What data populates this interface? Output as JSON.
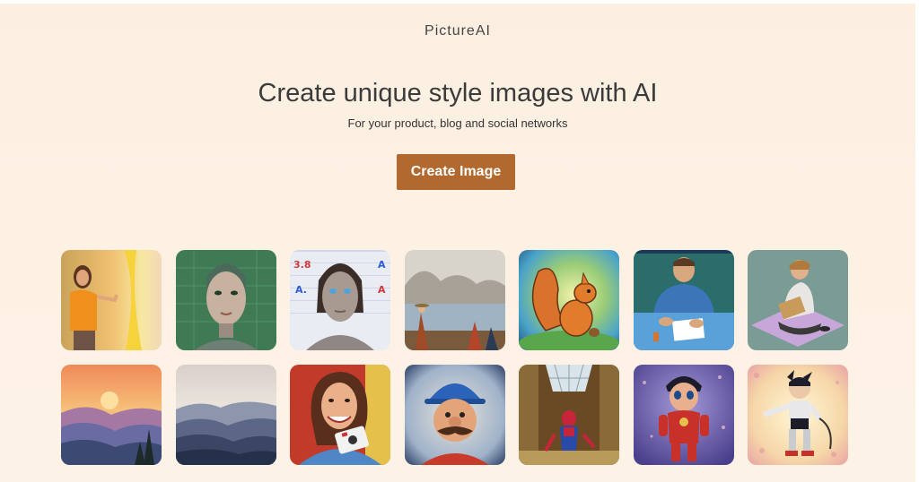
{
  "header": {
    "brand": "PictureAI"
  },
  "hero": {
    "title": "Create unique style images with AI",
    "subtitle": "For your product, blog and social networks",
    "cta_label": "Create Image"
  },
  "colors": {
    "cta_background": "#b2692f",
    "page_background": "#fcefe2"
  },
  "gallery": {
    "images": [
      {
        "name": "woman-pointing-image"
      },
      {
        "name": "robot-woman-portrait-image"
      },
      {
        "name": "android-face-letters-image"
      },
      {
        "name": "lakeside-painting-image"
      },
      {
        "name": "squirrel-image"
      },
      {
        "name": "man-writing-image"
      },
      {
        "name": "person-reading-image"
      },
      {
        "name": "sunset-mountains-image"
      },
      {
        "name": "blue-mountains-image"
      },
      {
        "name": "smiling-woman-camera-image"
      },
      {
        "name": "mustache-man-cap-image"
      },
      {
        "name": "spider-hero-image"
      },
      {
        "name": "red-robot-boy-image"
      },
      {
        "name": "astro-robot-image"
      }
    ]
  }
}
